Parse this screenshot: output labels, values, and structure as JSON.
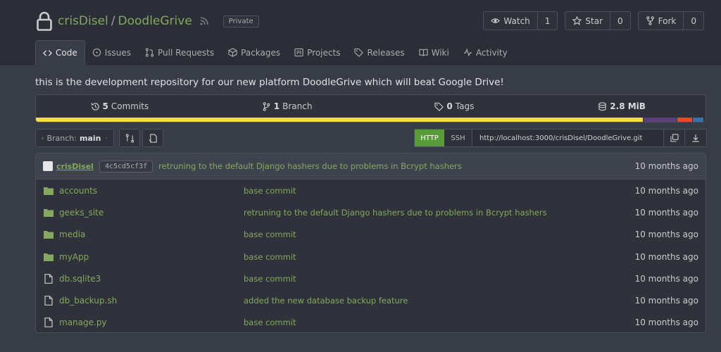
{
  "repo": {
    "owner": "crisDisel",
    "separator": "/",
    "name": "DoodleGrive",
    "badge": "Private",
    "description": "this is the development repository for our new platform DoodleGrive which will beat Google Drive!"
  },
  "actions": [
    {
      "label": "Watch",
      "count": "1",
      "icon": "eye-icon"
    },
    {
      "label": "Star",
      "count": "0",
      "icon": "star-icon"
    },
    {
      "label": "Fork",
      "count": "0",
      "icon": "fork-icon"
    }
  ],
  "tabs": [
    {
      "label": "Code",
      "icon": "code-icon",
      "active": true
    },
    {
      "label": "Issues",
      "icon": "issue-icon"
    },
    {
      "label": "Pull Requests",
      "icon": "pull-request-icon"
    },
    {
      "label": "Packages",
      "icon": "package-icon"
    },
    {
      "label": "Projects",
      "icon": "project-icon"
    },
    {
      "label": "Releases",
      "icon": "tag-icon"
    },
    {
      "label": "Wiki",
      "icon": "book-icon"
    },
    {
      "label": "Activity",
      "icon": "pulse-icon"
    }
  ],
  "stats": {
    "commits_count": "5",
    "commits_label": "Commits",
    "branch_count": "1",
    "branch_label": "Branch",
    "tags_count": "0",
    "tags_label": "Tags",
    "size": "2.8 MiB"
  },
  "languages": [
    {
      "color": "#f2da50",
      "fraction": 0.909
    },
    {
      "color": "#5a3f7c",
      "fraction": 0.05
    },
    {
      "color": "#e34c26",
      "fraction": 0.022
    },
    {
      "color": "#3572a5",
      "fraction": 0.016
    }
  ],
  "toolbar": {
    "branch_prefix": "Branch:",
    "branch_name": "main",
    "http_label": "HTTP",
    "ssh_label": "SSH",
    "clone_url": "http://localhost:3000/crisDisel/DoodleGrive.git"
  },
  "latest_commit": {
    "author": "crisDisel",
    "sha": "4c5cd5cf3f",
    "message": "retruning to the default Django hashers due to problems in Bcrypt hashers",
    "time": "10 months ago"
  },
  "files": [
    {
      "name": "accounts",
      "type": "dir",
      "message": "base commit",
      "time": "10 months ago"
    },
    {
      "name": "geeks_site",
      "type": "dir",
      "message": "retruning to the default Django hashers due to problems in Bcrypt hashers",
      "time": "10 months ago"
    },
    {
      "name": "media",
      "type": "dir",
      "message": "base commit",
      "time": "10 months ago"
    },
    {
      "name": "myApp",
      "type": "dir",
      "message": "base commit",
      "time": "10 months ago"
    },
    {
      "name": "db.sqlite3",
      "type": "file",
      "message": "base commit",
      "time": "10 months ago"
    },
    {
      "name": "db_backup.sh",
      "type": "file",
      "message": "added the new database backup feature",
      "time": "10 months ago"
    },
    {
      "name": "manage.py",
      "type": "file",
      "message": "base commit",
      "time": "10 months ago"
    }
  ],
  "colors": {
    "accent": "#83a85d",
    "http_active": "#5a9b3a"
  }
}
